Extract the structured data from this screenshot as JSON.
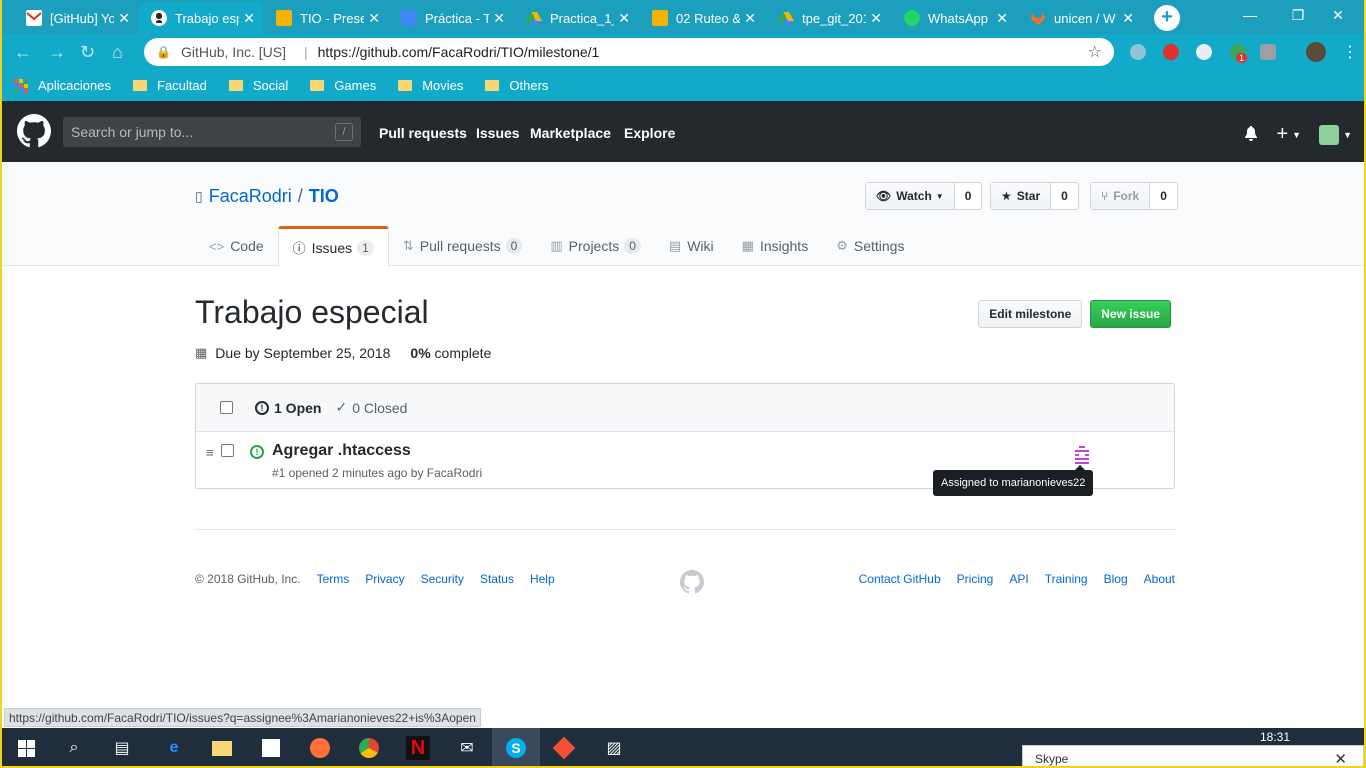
{
  "browser": {
    "tabs": [
      {
        "label": "[GitHub] Yo",
        "icon": "gmail-icon",
        "color": "#d93025"
      },
      {
        "label": "Trabajo esp",
        "icon": "github-icon",
        "color": "#ffffff",
        "active": true
      },
      {
        "label": "TIO - Prese",
        "icon": "slides-icon",
        "color": "#f4b400"
      },
      {
        "label": "Práctica - T",
        "icon": "forms-icon",
        "color": "#4285f4"
      },
      {
        "label": "Practica_1_",
        "icon": "drive-icon",
        "color": "#34a853"
      },
      {
        "label": "02 Ruteo &",
        "icon": "slides-icon",
        "color": "#f4b400"
      },
      {
        "label": "tpe_git_201",
        "icon": "drive-icon",
        "color": "#34a853"
      },
      {
        "label": "WhatsApp",
        "icon": "whatsapp-icon",
        "color": "#25d366"
      },
      {
        "label": "unicen / W",
        "icon": "gitlab-icon",
        "color": "#fc6d26"
      }
    ],
    "tab_close": "✕",
    "new_tab": "+",
    "window_controls": {
      "minimize": "—",
      "maximize": "❐",
      "close": "✕"
    },
    "secure_label": "GitHub, Inc. [US]",
    "url": "https://github.com/FacaRodri/TIO/milestone/1",
    "extension_badge": "1",
    "bookmarks": [
      {
        "label": "Aplicaciones",
        "icon": "apps-grid-icon"
      },
      {
        "label": "Facultad",
        "icon": "folder-icon"
      },
      {
        "label": "Social",
        "icon": "folder-icon"
      },
      {
        "label": "Games",
        "icon": "folder-icon"
      },
      {
        "label": "Movies",
        "icon": "folder-icon"
      },
      {
        "label": "Others",
        "icon": "folder-icon"
      }
    ],
    "status_url": "https://github.com/FacaRodri/TIO/issues?q=assignee%3Amarianonieves22+is%3Aopen"
  },
  "github": {
    "search_placeholder": "Search or jump to...",
    "search_shortcut": "/",
    "nav": [
      "Pull requests",
      "Issues",
      "Marketplace",
      "Explore"
    ]
  },
  "repo": {
    "owner": "FacaRodri",
    "separator": "/",
    "name": "TIO",
    "watch": {
      "label": "Watch",
      "count": "0"
    },
    "star": {
      "label": "Star",
      "count": "0"
    },
    "fork": {
      "label": "Fork",
      "count": "0"
    },
    "tabs": [
      {
        "label": "Code",
        "icon": "code-icon"
      },
      {
        "label": "Issues",
        "icon": "issue-icon",
        "count": "1",
        "selected": true
      },
      {
        "label": "Pull requests",
        "icon": "pull-request-icon",
        "count": "0"
      },
      {
        "label": "Projects",
        "icon": "project-icon",
        "count": "0"
      },
      {
        "label": "Wiki",
        "icon": "book-icon"
      },
      {
        "label": "Insights",
        "icon": "graph-icon"
      },
      {
        "label": "Settings",
        "icon": "gear-icon"
      }
    ]
  },
  "milestone": {
    "title": "Trabajo especial",
    "edit_label": "Edit milestone",
    "new_issue_label": "New issue",
    "due": "Due by September 25, 2018",
    "percent": "0%",
    "percent_suffix": " complete",
    "open_label": "1 Open",
    "closed_label": "0 Closed"
  },
  "issues": [
    {
      "title": "Agregar .htaccess",
      "meta": "#1 opened 2 minutes ago by FacaRodri",
      "assignee_tooltip": "Assigned to marianonieves22"
    }
  ],
  "footer": {
    "copyright": "© 2018 GitHub, Inc.",
    "left_links": [
      "Terms",
      "Privacy",
      "Security",
      "Status",
      "Help"
    ],
    "right_links": [
      "Contact GitHub",
      "Pricing",
      "API",
      "Training",
      "Blog",
      "About"
    ]
  },
  "taskbar": {
    "time": "18:31",
    "notification_title": "Skype",
    "notification_close": "✕",
    "apps": [
      "start-icon",
      "search-icon",
      "task-view-icon",
      "edge-icon",
      "file-explorer-icon",
      "store-icon",
      "firefox-icon",
      "chrome-icon",
      "netflix-icon",
      "mail-icon",
      "skype-icon",
      "git-icon",
      "photos-icon"
    ]
  },
  "colors": {
    "chrome_theme": "#13a9c9",
    "github_header": "#24292e",
    "link": "#0366d6",
    "primary_button": "#28a745",
    "selected_tab_accent": "#e36209"
  }
}
